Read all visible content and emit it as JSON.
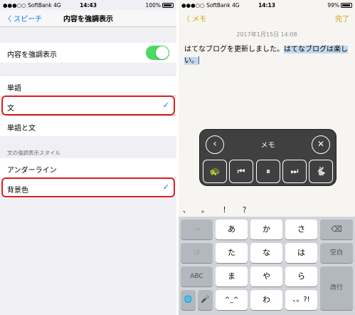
{
  "left": {
    "status": {
      "carrier": "●●●○○ SoftBank",
      "network": "4G",
      "time": "14:43",
      "battery": "100%"
    },
    "nav": {
      "back": "〈 スピーチ",
      "title": "内容を強調表示"
    },
    "highlight_row": {
      "label": "内容を強調表示",
      "enabled": true
    },
    "options": [
      "単語",
      "文",
      "単語と文"
    ],
    "options_selected_index": 1,
    "style_header": "文の強調表示スタイル",
    "styles": [
      "アンダーライン",
      "背景色"
    ],
    "styles_selected_index": 1,
    "check_mark": "✓"
  },
  "right": {
    "status": {
      "carrier": "●●●○○ SoftBank",
      "network": "4G",
      "time": "14:13",
      "battery": "99%"
    },
    "nav": {
      "back": "〈 メモ",
      "done": "完了"
    },
    "date": "2017年1月15日 14:08",
    "note": {
      "plain": "はてなブログを更新しました。",
      "selected": "はてなブログは楽しい。"
    },
    "panel": {
      "title": "メモ",
      "back_icon": "‹",
      "close_icon": "✕",
      "buttons": [
        "🐢",
        "⏮",
        "⏸",
        "⏭",
        "🐇"
      ]
    },
    "punctuation": [
      "、",
      "。",
      "！",
      "？"
    ],
    "keyboard": {
      "row1": [
        "→",
        "あ",
        "か",
        "さ",
        "⌫"
      ],
      "row2": [
        "↺",
        "た",
        "な",
        "は",
        "空白"
      ],
      "row3": [
        "ABC",
        "ま",
        "や",
        "ら"
      ],
      "row4": [
        "🌐",
        "🎤",
        "^_^",
        "わ",
        "、。?!"
      ],
      "enter": "改行"
    }
  },
  "colors": {
    "ios_blue": "#007aff",
    "notes_yellow": "#d89c00",
    "toggle_green": "#4cd964",
    "highlight_red": "#e11b22"
  }
}
